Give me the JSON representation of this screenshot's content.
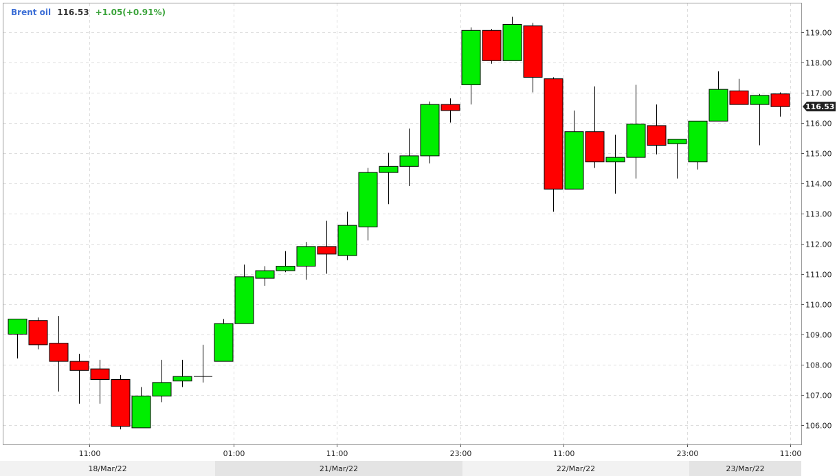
{
  "legend": {
    "name": "Brent oil",
    "price": "116.53",
    "change": "+1.05(+0.91%)"
  },
  "colors": {
    "up": "#00ee00",
    "down": "#ff0000",
    "wick": "#000000",
    "grid": "#dddddd",
    "legend_name": "#3d6fd6",
    "legend_change": "#3aa33a"
  },
  "chart_data": {
    "type": "candlestick",
    "title": "",
    "instrument": "Brent oil",
    "last_price": "116.53",
    "ylim": [
      105.3,
      119.85
    ],
    "y_ticks": [
      "106.00",
      "107.00",
      "108.00",
      "109.00",
      "110.00",
      "111.00",
      "112.00",
      "113.00",
      "114.00",
      "115.00",
      "116.00",
      "117.00",
      "118.00",
      "119.00"
    ],
    "x_tick_labels": [
      {
        "label": "11:00",
        "index": 3.5
      },
      {
        "label": "01:00",
        "index": 10.5
      },
      {
        "label": "11:00",
        "index": 15.5
      },
      {
        "label": "23:00",
        "index": 21.5
      },
      {
        "label": "11:00",
        "index": 26.5
      },
      {
        "label": "23:00",
        "index": 32.5
      },
      {
        "label": "11:00",
        "index": 37.5
      }
    ],
    "date_labels": [
      {
        "label": "18/Mar/22",
        "start": 0,
        "end": 9.6
      },
      {
        "label": "21/Mar/22",
        "start": 9.6,
        "end": 21.6
      },
      {
        "label": "22/Mar/22",
        "start": 21.6,
        "end": 32.6
      },
      {
        "label": "23/Mar/22",
        "start": 32.6,
        "end": 38.6
      }
    ],
    "grid": true,
    "candles": [
      {
        "o": 109.0,
        "h": 109.5,
        "l": 108.2,
        "c": 109.5
      },
      {
        "o": 109.45,
        "h": 109.55,
        "l": 108.5,
        "c": 108.65
      },
      {
        "o": 108.7,
        "h": 109.6,
        "l": 107.1,
        "c": 108.1
      },
      {
        "o": 108.1,
        "h": 108.35,
        "l": 106.7,
        "c": 107.8
      },
      {
        "o": 107.85,
        "h": 108.15,
        "l": 106.7,
        "c": 107.5
      },
      {
        "o": 107.5,
        "h": 107.65,
        "l": 105.85,
        "c": 105.95
      },
      {
        "o": 105.9,
        "h": 107.25,
        "l": 105.9,
        "c": 106.95
      },
      {
        "o": 106.95,
        "h": 108.15,
        "l": 106.75,
        "c": 107.4
      },
      {
        "o": 107.45,
        "h": 108.15,
        "l": 107.25,
        "c": 107.6
      },
      {
        "o": 107.6,
        "h": 108.65,
        "l": 107.4,
        "c": 107.6
      },
      {
        "o": 108.1,
        "h": 109.5,
        "l": 108.1,
        "c": 109.35
      },
      {
        "o": 109.35,
        "h": 111.3,
        "l": 109.35,
        "c": 110.9
      },
      {
        "o": 110.85,
        "h": 111.25,
        "l": 110.6,
        "c": 111.1
      },
      {
        "o": 111.1,
        "h": 111.75,
        "l": 111.05,
        "c": 111.25
      },
      {
        "o": 111.25,
        "h": 112.05,
        "l": 110.8,
        "c": 111.9
      },
      {
        "o": 111.9,
        "h": 112.75,
        "l": 111.0,
        "c": 111.65
      },
      {
        "o": 111.6,
        "h": 113.05,
        "l": 111.45,
        "c": 112.6
      },
      {
        "o": 112.55,
        "h": 114.5,
        "l": 112.1,
        "c": 114.35
      },
      {
        "o": 114.35,
        "h": 115.0,
        "l": 113.3,
        "c": 114.55
      },
      {
        "o": 114.55,
        "h": 115.8,
        "l": 113.9,
        "c": 114.9
      },
      {
        "o": 114.9,
        "h": 116.7,
        "l": 114.65,
        "c": 116.6
      },
      {
        "o": 116.6,
        "h": 116.8,
        "l": 116.0,
        "c": 116.4
      },
      {
        "o": 117.25,
        "h": 119.15,
        "l": 116.6,
        "c": 119.05
      },
      {
        "o": 119.05,
        "h": 119.1,
        "l": 117.95,
        "c": 118.05
      },
      {
        "o": 118.05,
        "h": 119.5,
        "l": 118.05,
        "c": 119.25
      },
      {
        "o": 119.2,
        "h": 119.3,
        "l": 117.0,
        "c": 117.5
      },
      {
        "o": 117.45,
        "h": 117.5,
        "l": 113.05,
        "c": 113.8
      },
      {
        "o": 113.8,
        "h": 116.4,
        "l": 113.8,
        "c": 115.7
      },
      {
        "o": 115.7,
        "h": 117.2,
        "l": 114.5,
        "c": 114.7
      },
      {
        "o": 114.7,
        "h": 115.6,
        "l": 113.65,
        "c": 114.85
      },
      {
        "o": 114.85,
        "h": 117.25,
        "l": 114.15,
        "c": 115.95
      },
      {
        "o": 115.9,
        "h": 116.6,
        "l": 114.95,
        "c": 115.25
      },
      {
        "o": 115.3,
        "h": 115.45,
        "l": 114.15,
        "c": 115.45
      },
      {
        "o": 114.7,
        "h": 116.05,
        "l": 114.45,
        "c": 116.05
      },
      {
        "o": 116.05,
        "h": 117.7,
        "l": 116.05,
        "c": 117.1
      },
      {
        "o": 117.05,
        "h": 117.45,
        "l": 116.6,
        "c": 116.6
      },
      {
        "o": 116.6,
        "h": 116.95,
        "l": 115.25,
        "c": 116.9
      },
      {
        "o": 116.95,
        "h": 117.0,
        "l": 116.2,
        "c": 116.53
      }
    ]
  }
}
